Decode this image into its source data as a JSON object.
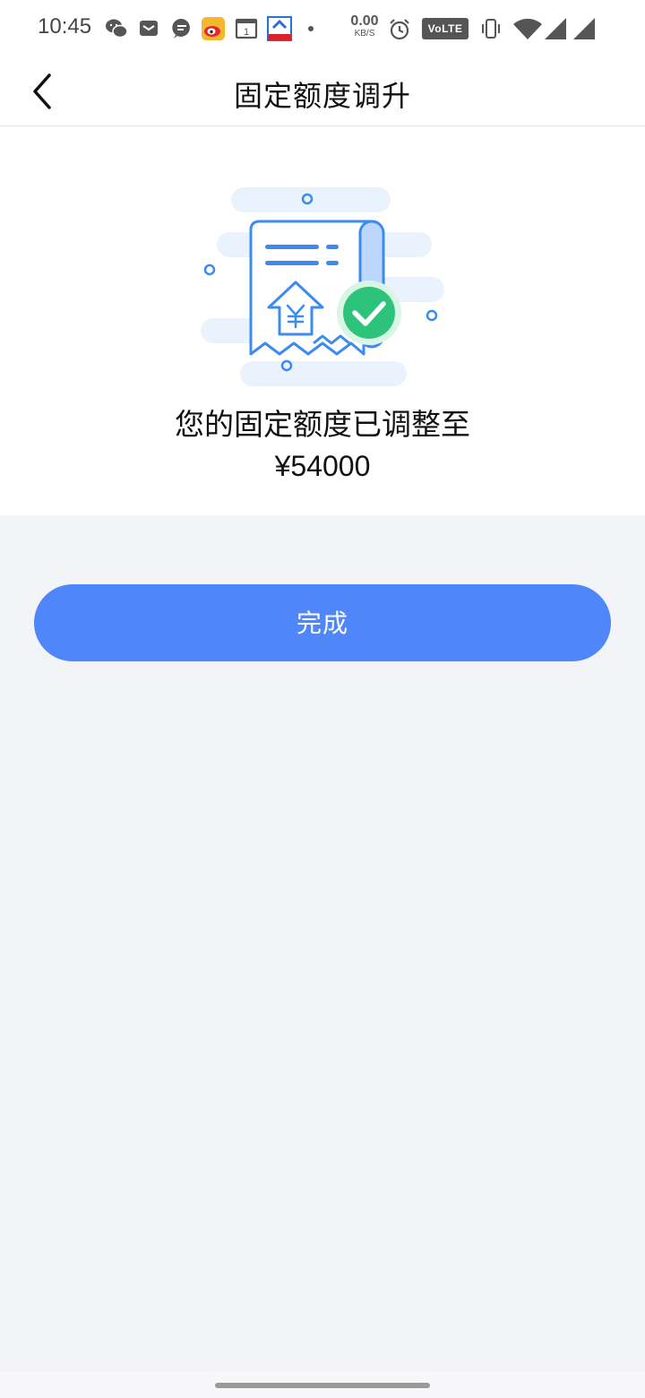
{
  "status_bar": {
    "time": "10:45",
    "net_speed_value": "0.00",
    "net_speed_unit": "KB/S",
    "volte_label": "VoLTE",
    "icons": [
      "wechat-icon",
      "mail-icon",
      "message-icon",
      "weibo-icon",
      "calendar-icon",
      "app-icon",
      "dot-icon",
      "alarm-icon",
      "vibrate-icon",
      "wifi-icon",
      "signal-icon",
      "signal-icon-2"
    ],
    "calendar_day": "1"
  },
  "header": {
    "title": "固定额度调升",
    "back_icon": "chevron-left-icon"
  },
  "result": {
    "message": "您的固定额度已调整至",
    "amount": "¥54000",
    "illustration": "receipt-success-icon"
  },
  "actions": {
    "done_label": "完成"
  },
  "colors": {
    "primary": "#4f86fa",
    "success": "#2ec37a",
    "page_bg": "#f2f4f8",
    "illustration_blue": "#3b8bf0"
  }
}
